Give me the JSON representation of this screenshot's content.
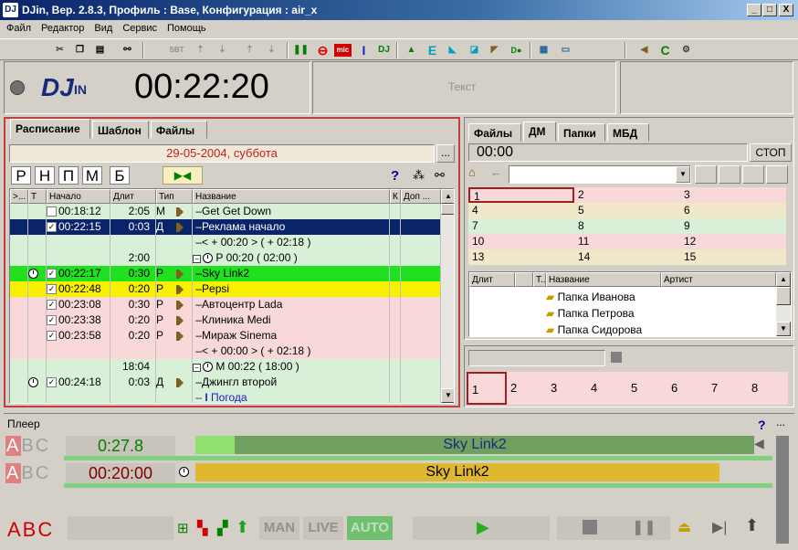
{
  "window": {
    "title": "DJin, Вер. 2.8.3, Профиль : Base, Конфигурация : air_x",
    "logo": "DJ",
    "min": "_",
    "max": "□",
    "close": "X"
  },
  "menu": [
    "Файл",
    "Редактор",
    "Вид",
    "Сервис",
    "Помощь"
  ],
  "toolbar": {
    "sbt": "SBT",
    "mic": "mic",
    "i": "I",
    "dj": "DJ",
    "e": "E",
    "c": "C"
  },
  "top": {
    "logo_dj": "DJ",
    "logo_in": "IN",
    "clock": "00:22:20",
    "text_box": "Текст"
  },
  "schedule": {
    "tabs": [
      "Расписание",
      "Шаблон",
      "Файлы"
    ],
    "date": "29-05-2004, суббота",
    "date_btn": "...",
    "filters": [
      "Р",
      "Н",
      "П",
      "М",
      "Б"
    ],
    "help": "?",
    "columns": [
      ">...",
      "Т",
      "Начало",
      "Длит",
      "Тип",
      "Название",
      "К",
      "Доп ..."
    ],
    "rows": [
      {
        "start": "00:18:12",
        "dur": "2:05",
        "type": "М",
        "name": "Get Get Down",
        "bg": "#d8f0d8",
        "check": false,
        "spk": true
      },
      {
        "start": "00:22:15",
        "dur": "0:03",
        "type": "Д",
        "name": "Реклама начало",
        "bg": "#0a246a",
        "fg": "#fff",
        "check": true,
        "spk": true
      },
      {
        "start": "",
        "dur": "",
        "type": "",
        "name": "< + 00:20 > ( + 02:18 )",
        "bg": "#d8f0d8"
      },
      {
        "start": "",
        "dur": "2:00",
        "type": "",
        "name": "Р 00:20 ( 02:00 )",
        "bg": "#d8f0d8",
        "block": true
      },
      {
        "start": "00:22:17",
        "dur": "0:30",
        "type": "Р",
        "name": "Sky Link2",
        "bg": "#20e020",
        "check": true,
        "spk": true,
        "clock": true
      },
      {
        "start": "00:22:48",
        "dur": "0:20",
        "type": "Р",
        "name": "Pepsi",
        "bg": "#f8f000",
        "check": true,
        "spk": true
      },
      {
        "start": "00:23:08",
        "dur": "0:30",
        "type": "Р",
        "name": "Автоцентр Lada",
        "bg": "#f8d8d8",
        "check": true,
        "spk": true
      },
      {
        "start": "00:23:38",
        "dur": "0:20",
        "type": "Р",
        "name": "Клиника Medi",
        "bg": "#f8d8d8",
        "check": true,
        "spk": true
      },
      {
        "start": "00:23:58",
        "dur": "0:20",
        "type": "Р",
        "name": "Мираж Sinema",
        "bg": "#f8d8d8",
        "check": true,
        "spk": true
      },
      {
        "start": "",
        "dur": "",
        "type": "",
        "name": "< + 00:00 > ( + 02:18 )",
        "bg": "#f8d8d8"
      },
      {
        "start": "",
        "dur": "18:04",
        "type": "",
        "name": "М 00:22 ( 18:00 )",
        "bg": "#d8f0d8",
        "block": true
      },
      {
        "start": "00:24:18",
        "dur": "0:03",
        "type": "Д",
        "name": "Джингл второй",
        "bg": "#d8f0d8",
        "check": true,
        "spk": true,
        "clock": true
      },
      {
        "start": "",
        "dur": "",
        "type": "",
        "name": "Погода",
        "bg": "#d8f0d8",
        "info": true
      }
    ]
  },
  "dm": {
    "tabs": [
      "Файлы",
      "ДМ",
      "Папки",
      "МБД"
    ],
    "time": "00:00",
    "stop": "СТОП",
    "cells": [
      [
        "1",
        "2",
        "3"
      ],
      [
        "4",
        "5",
        "6"
      ],
      [
        "7",
        "8",
        "9"
      ],
      [
        "10",
        "11",
        "12"
      ],
      [
        "13",
        "14",
        "15"
      ]
    ],
    "list_columns": [
      "Длит",
      "Т..",
      "Название",
      "Артист"
    ],
    "folders": [
      "Папка Иванова",
      "Папка Петрова",
      "Папка Сидорова"
    ],
    "pages": [
      "1",
      "2",
      "3",
      "4",
      "5",
      "6",
      "7",
      "8"
    ]
  },
  "player": {
    "title": "Плеер",
    "help": "?",
    "more": "...",
    "deck1": {
      "abc": [
        "A",
        "B",
        "C"
      ],
      "time": "0:27.8",
      "track": "Sky Link2",
      "progress": 0.07
    },
    "deck2": {
      "abc": [
        "A",
        "B",
        "C"
      ],
      "time": "00:20:00",
      "track": "Sky Link2",
      "progress": 1.0
    },
    "bottom_abc": "ABC",
    "modes": [
      "MAN",
      "LIVE",
      "AUTO"
    ]
  },
  "colors": {
    "accent": "#0a246a",
    "selected_row": "#0a246a",
    "green_row": "#20e020",
    "yellow_row": "#f8f000",
    "pink_row": "#f8d8d8",
    "lightgreen_row": "#d8f0d8",
    "red": "#d00000"
  }
}
